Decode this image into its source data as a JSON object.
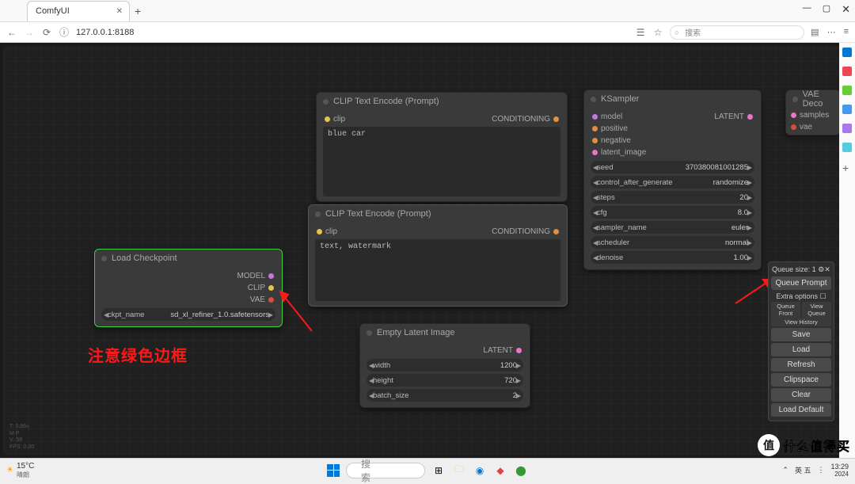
{
  "browser": {
    "tab_title": "ComfyUI",
    "url": "127.0.0.1:8188",
    "search_placeholder": "搜索"
  },
  "nodes": {
    "load_checkpoint": {
      "title": "Load Checkpoint",
      "out_model": "MODEL",
      "out_clip": "CLIP",
      "out_vae": "VAE",
      "ckpt_label": "ckpt_name",
      "ckpt_value": "sd_xl_refiner_1.0.safetensors"
    },
    "clip1": {
      "title": "CLIP Text Encode (Prompt)",
      "in_clip": "clip",
      "out_cond": "CONDITIONING",
      "text": "blue car"
    },
    "clip2": {
      "title": "CLIP Text Encode (Prompt)",
      "in_clip": "clip",
      "out_cond": "CONDITIONING",
      "text": "text, watermark"
    },
    "empty_latent": {
      "title": "Empty Latent Image",
      "out_latent": "LATENT",
      "width_label": "width",
      "width_value": "1200",
      "height_label": "height",
      "height_value": "720",
      "batch_label": "batch_size",
      "batch_value": "2"
    },
    "ksampler": {
      "title": "KSampler",
      "in_model": "model",
      "in_positive": "positive",
      "in_negative": "negative",
      "in_latent": "latent_image",
      "out_latent": "LATENT",
      "seed_label": "seed",
      "seed_value": "370380081001285",
      "ctrl_label": "control_after_generate",
      "ctrl_value": "randomize",
      "steps_label": "steps",
      "steps_value": "20",
      "cfg_label": "cfg",
      "cfg_value": "8.0",
      "sampler_label": "sampler_name",
      "sampler_value": "euler",
      "sched_label": "scheduler",
      "sched_value": "normal",
      "denoise_label": "denoise",
      "denoise_value": "1.00"
    },
    "vae_decode": {
      "title": "VAE Deco",
      "in_samples": "samples",
      "in_vae": "vae"
    }
  },
  "panel": {
    "queue_size": "Queue size: 1",
    "queue_prompt": "Queue Prompt",
    "extra_options": "Extra options",
    "queue_front": "Queue Front",
    "view_queue": "View Queue",
    "view_history": "View History",
    "save": "Save",
    "load": "Load",
    "refresh": "Refresh",
    "clipspace": "Clipspace",
    "clear": "Clear",
    "load_default": "Load Default"
  },
  "annotation": {
    "text": "注意绿色边框"
  },
  "taskbar": {
    "weather_temp": "15°C",
    "weather_desc": "晴朗",
    "search_placeholder": "搜索",
    "ime": "英 五",
    "time": "13:29",
    "date": "2024"
  },
  "watermark": {
    "logo": "值",
    "text": "什么值得买"
  },
  "debug": "T: 0.86u\nM P\nV: 58\nFPS: 0.00"
}
